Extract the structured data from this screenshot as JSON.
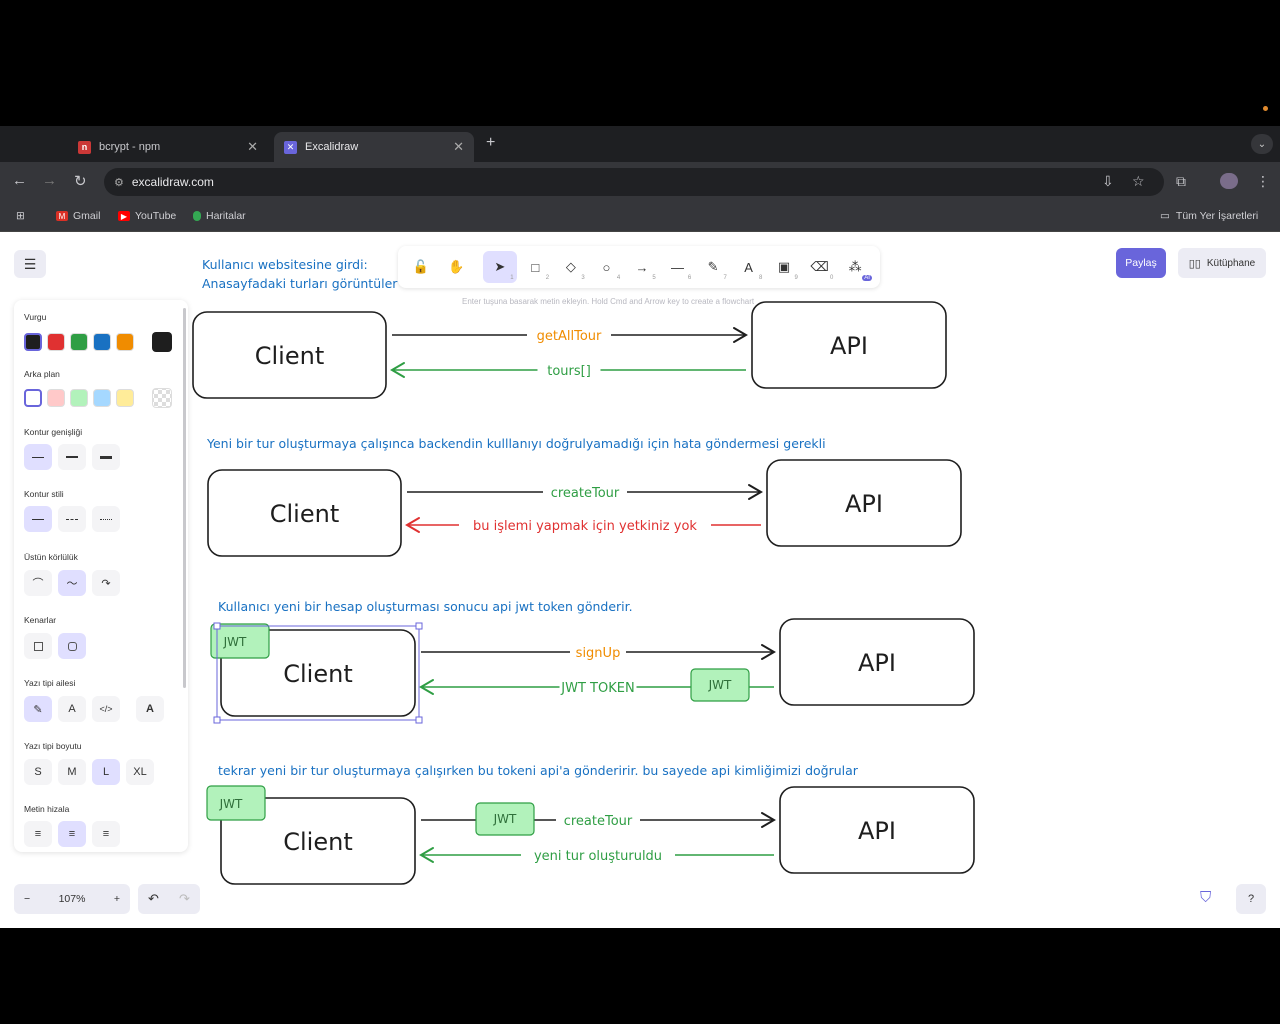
{
  "browser": {
    "tabs": [
      {
        "title": "bcrypt - npm",
        "icon": "npm-favicon",
        "active": false
      },
      {
        "title": "Excalidraw",
        "icon": "excalidraw-favicon",
        "active": true
      }
    ],
    "url": "excalidraw.com",
    "bookmarks": [
      {
        "label": "Gmail",
        "icon": "gmail-icon"
      },
      {
        "label": "YouTube",
        "icon": "youtube-icon"
      },
      {
        "label": "Haritalar",
        "icon": "maps-icon"
      }
    ],
    "all_bookmarks": "Tüm Yer İşaretleri"
  },
  "excalidraw": {
    "share_label": "Paylaş",
    "library_label": "Kütüphane",
    "hint": "Enter tuşuna basarak metin ekleyin. Hold Cmd and Arrow key to create a flowchart",
    "zoom": "107%",
    "tools": [
      {
        "name": "lock-icon",
        "glyph": "🔓",
        "num": ""
      },
      {
        "name": "hand-icon",
        "glyph": "✋",
        "num": ""
      },
      {
        "name": "selection-icon",
        "glyph": "➤",
        "num": "1"
      },
      {
        "name": "rectangle-icon",
        "glyph": "□",
        "num": "2"
      },
      {
        "name": "diamond-icon",
        "glyph": "◇",
        "num": "3"
      },
      {
        "name": "ellipse-icon",
        "glyph": "○",
        "num": "4"
      },
      {
        "name": "arrow-icon",
        "glyph": "→",
        "num": "5"
      },
      {
        "name": "line-icon",
        "glyph": "—",
        "num": "6"
      },
      {
        "name": "draw-icon",
        "glyph": "✎",
        "num": "7"
      },
      {
        "name": "text-icon",
        "glyph": "A",
        "num": "8"
      },
      {
        "name": "image-icon",
        "glyph": "▣",
        "num": "9"
      },
      {
        "name": "eraser-icon",
        "glyph": "⌫",
        "num": "0"
      },
      {
        "name": "extra-tools-icon",
        "glyph": "⁂",
        "num": "AI"
      }
    ],
    "props": {
      "stroke_title": "Vurgu",
      "stroke_colors": [
        "#1e1e1e",
        "#e03131",
        "#2f9e44",
        "#1971c2",
        "#f08c00"
      ],
      "stroke_current": "#1e1e1e",
      "background_title": "Arka plan",
      "background_colors": [
        "#ffffff",
        "#ffc9c9",
        "#b2f2bb",
        "#a5d8ff",
        "#ffec99"
      ],
      "stroke_width_title": "Kontur genişliği",
      "stroke_style_title": "Kontur stili",
      "sloppiness_title": "Üstün körlülük",
      "edges_title": "Kenarlar",
      "font_family_title": "Yazı tipi ailesi",
      "font_size_title": "Yazı tipi boyutu",
      "font_sizes": [
        "S",
        "M",
        "L",
        "XL"
      ],
      "text_align_title": "Metin hizala"
    }
  },
  "diagram": {
    "scenes": [
      {
        "caption_lines": [
          "Kullanıcı websitesine girdi:",
          "Anasayfadaki turları görüntüler"
        ],
        "client": "Client",
        "api": "API",
        "forward_label": "getAllTour",
        "back_label": "tours[]",
        "forward_color": "#f08c00",
        "back_color": "#2f9e44"
      },
      {
        "caption_lines": [
          "Yeni bir tur oluşturmaya çalışınca backendin kulllanıyı doğrulyamadığı için hata göndermesi gerekli"
        ],
        "client": "Client",
        "api": "API",
        "forward_label": "createTour",
        "back_label": "bu işlemi yapmak için yetkiniz yok",
        "forward_color": "#2f9e44",
        "back_color": "#e03131"
      },
      {
        "caption_lines": [
          "Kullanıcı yeni bir hesap oluşturması sonucu api jwt token gönderir."
        ],
        "client": "Client",
        "api": "API",
        "forward_label": "signUp",
        "back_label": "JWT TOKEN",
        "jwt_tag": "JWT",
        "jwt_on_arrow": "JWT",
        "forward_color": "#f08c00",
        "back_color": "#2f9e44"
      },
      {
        "caption_lines": [
          "tekrar yeni bir tur oluşturmaya çalışırken bu tokeni api'a gönderirir. bu sayede api kimliğimizi doğrular"
        ],
        "client": "Client",
        "api": "API",
        "forward_label": "createTour",
        "back_label": "yeni tur oluşturuldu",
        "jwt_tag": "JWT",
        "jwt_on_arrow": "JWT",
        "forward_color": "#2f9e44",
        "back_color": "#2f9e44"
      }
    ],
    "caption_color": "#1971c2",
    "tag_fill": "#b2f2bb",
    "tag_stroke": "#2f9e44"
  }
}
